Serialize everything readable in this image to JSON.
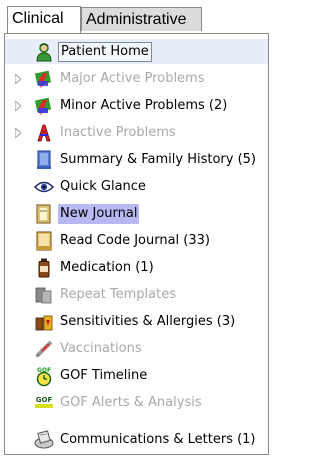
{
  "tabs": [
    {
      "label": "Clinical",
      "active": true
    },
    {
      "label": "Administrative",
      "active": false
    }
  ],
  "tree": {
    "items": [
      {
        "label": "Patient Home",
        "icon": "patient-home-icon",
        "disabled": false,
        "expandable": false,
        "state": "focused"
      },
      {
        "label": "Major Active Problems",
        "icon": "major-active-problems-icon",
        "disabled": true,
        "expandable": true,
        "state": ""
      },
      {
        "label": "Minor Active Problems (2)",
        "icon": "minor-active-problems-icon",
        "disabled": false,
        "expandable": true,
        "state": ""
      },
      {
        "label": "Inactive Problems",
        "icon": "inactive-problems-icon",
        "disabled": true,
        "expandable": true,
        "state": ""
      },
      {
        "label": "Summary & Family History (5)",
        "icon": "summary-history-icon",
        "disabled": false,
        "expandable": false,
        "state": ""
      },
      {
        "label": "Quick Glance",
        "icon": "eye-icon",
        "disabled": false,
        "expandable": false,
        "state": ""
      },
      {
        "label": "New Journal",
        "icon": "journal-icon",
        "disabled": false,
        "expandable": false,
        "state": "selected"
      },
      {
        "label": "Read Code Journal (33)",
        "icon": "read-code-journal-icon",
        "disabled": false,
        "expandable": false,
        "state": ""
      },
      {
        "label": "Medication (1)",
        "icon": "medication-bottle-icon",
        "disabled": false,
        "expandable": false,
        "state": ""
      },
      {
        "label": "Repeat Templates",
        "icon": "repeat-templates-icon",
        "disabled": true,
        "expandable": false,
        "state": ""
      },
      {
        "label": "Sensitivities & Allergies (3)",
        "icon": "allergies-icon",
        "disabled": false,
        "expandable": false,
        "state": ""
      },
      {
        "label": "Vaccinations",
        "icon": "syringe-icon",
        "disabled": true,
        "expandable": false,
        "state": ""
      },
      {
        "label": "GOF Timeline",
        "icon": "gof-timeline-icon",
        "disabled": false,
        "expandable": false,
        "state": ""
      },
      {
        "label": "GOF Alerts & Analysis",
        "icon": "gof-alerts-icon",
        "disabled": true,
        "expandable": false,
        "state": ""
      },
      {
        "label": "Communications & Letters (1)",
        "icon": "communications-icon",
        "disabled": false,
        "expandable": false,
        "state": ""
      }
    ]
  },
  "icon_badges": {
    "gof": "GOF"
  },
  "colors": {
    "selected_bg": "#b8b9f3",
    "disabled_text": "#a9a9a9",
    "tab_bg": "#dcdcdc"
  }
}
